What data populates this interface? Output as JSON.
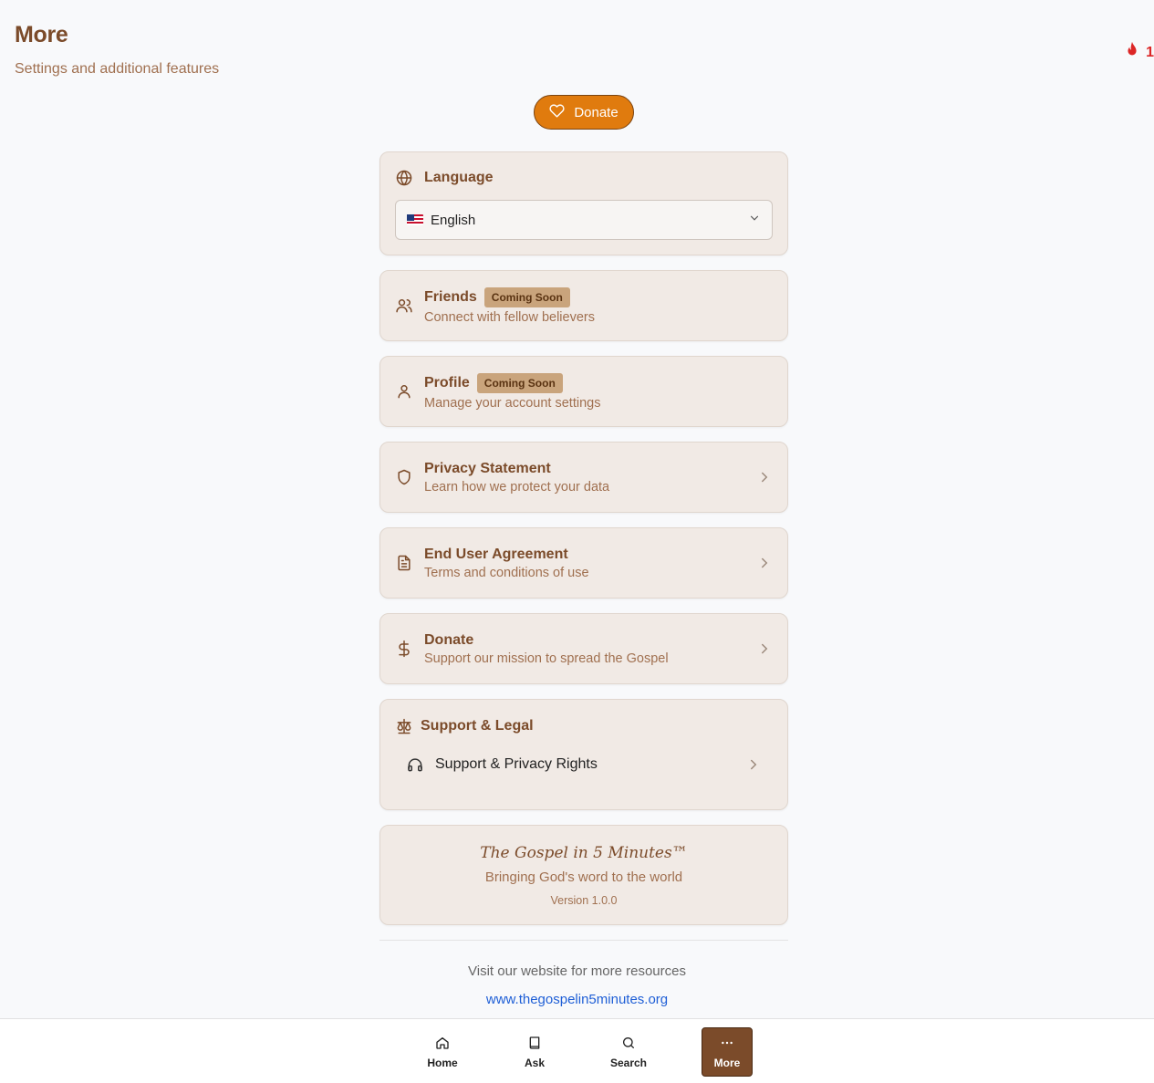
{
  "header": {
    "title": "More",
    "subtitle": "Settings and additional features",
    "streak_count": "1"
  },
  "donate_button": {
    "label": "Donate"
  },
  "language": {
    "title": "Language",
    "selected": "English"
  },
  "cards": [
    {
      "title": "Friends",
      "badge": "Coming Soon",
      "desc": "Connect with fellow believers"
    },
    {
      "title": "Profile",
      "badge": "Coming Soon",
      "desc": "Manage your account settings"
    },
    {
      "title": "Privacy Statement",
      "desc": "Learn how we protect your data"
    },
    {
      "title": "End User Agreement",
      "desc": "Terms and conditions of use"
    },
    {
      "title": "Donate",
      "desc": "Support our mission to spread the Gospel"
    }
  ],
  "support": {
    "title": "Support & Legal",
    "item": "Support & Privacy Rights"
  },
  "about": {
    "brand": "The Gospel in 5 Minutes™",
    "tagline": "Bringing God's word to the world",
    "version": "Version 1.0.0"
  },
  "footer": {
    "visit": "Visit our website for more resources",
    "link": "www.thegospelin5minutes.org"
  },
  "nav": [
    {
      "label": "Home",
      "icon": "home-icon"
    },
    {
      "label": "Ask",
      "icon": "book-icon"
    },
    {
      "label": "Search",
      "icon": "search-icon"
    },
    {
      "label": "More",
      "icon": "more-icon",
      "active": true
    }
  ],
  "colors": {
    "accent": "#e07b0e",
    "brand_brown": "#7b4b2a",
    "card_bg": "#f1eae5",
    "badge_bg": "#c9a47c",
    "link": "#1f5fd6",
    "streak": "#dc2626"
  }
}
